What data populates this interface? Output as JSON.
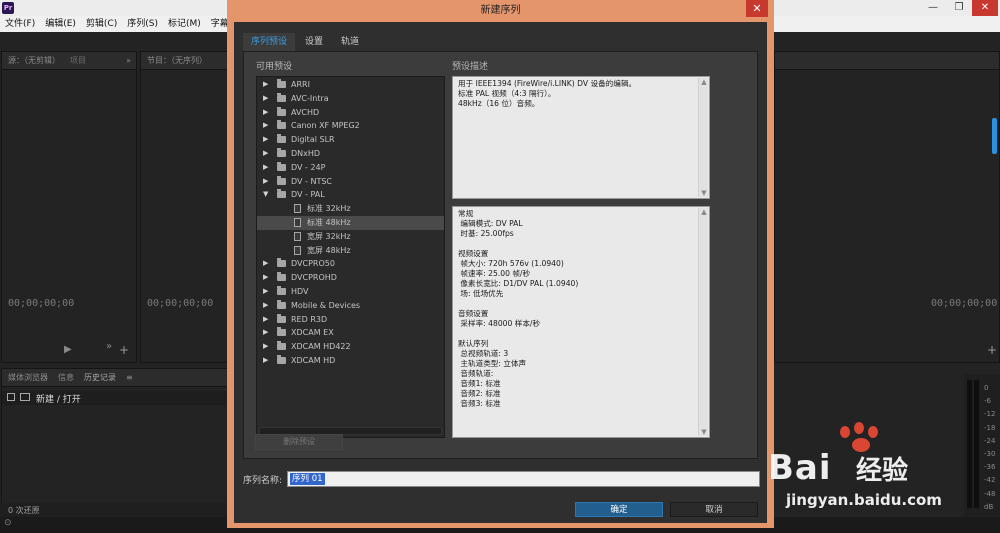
{
  "app": {
    "logo": "Pr",
    "window_controls": [
      "—",
      "❐",
      "✕"
    ],
    "menu": [
      "文件(F)",
      "编辑(E)",
      "剪辑(C)",
      "序列(S)",
      "标记(M)",
      "字幕("
    ]
  },
  "left_panel": {
    "tab1": "源：（无剪辑）",
    "tab2": "项目",
    "timecode": "00;00;00;00"
  },
  "mid_panel": {
    "tab": "节目：（无序列）",
    "timecode": "00;00;00;00"
  },
  "right_panel": {
    "timecode": "00;00;00;00"
  },
  "bottom_panel": {
    "tabs": [
      "媒体浏览器",
      "信息",
      "历史记录"
    ],
    "history_item": "新建 / 打开",
    "undo_count": "0 次还原"
  },
  "audio_meter": {
    "scale": [
      "0",
      "-6",
      "-12",
      "-18",
      "-24",
      "-30",
      "-36",
      "-42",
      "-48",
      "dB"
    ]
  },
  "dialog": {
    "title": "新建序列",
    "close": "✕",
    "tabs": [
      "序列预设",
      "设置",
      "轨道"
    ],
    "available_presets_label": "可用预设",
    "preset_description_label": "预设描述",
    "presets": [
      {
        "label": "ARRI",
        "type": "folder",
        "expanded": false
      },
      {
        "label": "AVC-Intra",
        "type": "folder",
        "expanded": false
      },
      {
        "label": "AVCHD",
        "type": "folder",
        "expanded": false
      },
      {
        "label": "Canon XF MPEG2",
        "type": "folder",
        "expanded": false
      },
      {
        "label": "Digital SLR",
        "type": "folder",
        "expanded": false
      },
      {
        "label": "DNxHD",
        "type": "folder",
        "expanded": false
      },
      {
        "label": "DV - 24P",
        "type": "folder",
        "expanded": false
      },
      {
        "label": "DV - NTSC",
        "type": "folder",
        "expanded": false
      },
      {
        "label": "DV - PAL",
        "type": "folder",
        "expanded": true
      },
      {
        "label": "标准 32kHz",
        "type": "file",
        "selected": false
      },
      {
        "label": "标准 48kHz",
        "type": "file",
        "selected": true
      },
      {
        "label": "宽屏 32kHz",
        "type": "file",
        "selected": false
      },
      {
        "label": "宽屏 48kHz",
        "type": "file",
        "selected": false
      },
      {
        "label": "DVCPRO50",
        "type": "folder",
        "expanded": false
      },
      {
        "label": "DVCPROHD",
        "type": "folder",
        "expanded": false
      },
      {
        "label": "HDV",
        "type": "folder",
        "expanded": false
      },
      {
        "label": "Mobile & Devices",
        "type": "folder",
        "expanded": false
      },
      {
        "label": "RED R3D",
        "type": "folder",
        "expanded": false
      },
      {
        "label": "XDCAM EX",
        "type": "folder",
        "expanded": false
      },
      {
        "label": "XDCAM HD422",
        "type": "folder",
        "expanded": false
      },
      {
        "label": "XDCAM HD",
        "type": "folder",
        "expanded": false
      }
    ],
    "description": "用于 IEEE1394 (FireWire/i.LINK) DV 设备的编辑。\n标准 PAL 视频（4:3 隔行）。\n48kHz（16 位）音频。",
    "general_info": "常规\n 编辑模式: DV PAL\n 时基: 25.00fps\n\n视频设置\n 帧大小: 720h 576v (1.0940)\n 帧速率: 25.00 帧/秒\n 像素长宽比: D1/DV PAL (1.0940)\n 场: 低场优先\n\n音频设置\n 采样率: 48000 样本/秒\n\n默认序列\n 总视频轨道: 3\n 主轨道类型: 立体声\n 音频轨道:\n 音频1: 标准\n 音频2: 标准\n 音频3: 标准",
    "delete_preset": "删除预设",
    "sequence_name_label": "序列名称:",
    "sequence_name_value": "序列 01",
    "ok": "确定",
    "cancel": "取消"
  },
  "watermark": {
    "brand": "Bai",
    "brand_suffix": "经验",
    "url": "jingyan.baidu.com"
  }
}
